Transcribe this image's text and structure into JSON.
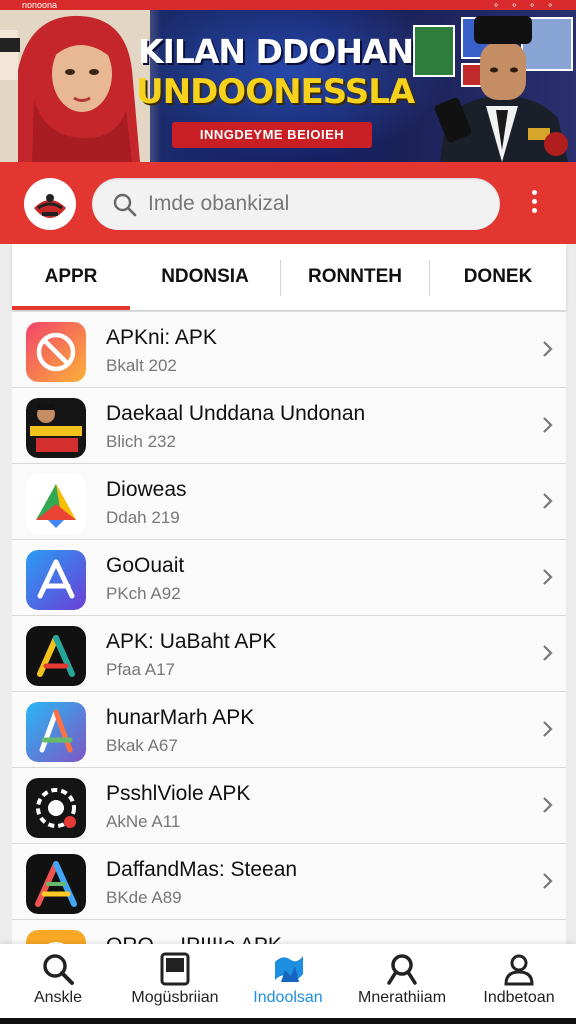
{
  "status_bar": {
    "left": "nonoona",
    "right": "⚬ ⚬ ⚬ ⚬"
  },
  "banner": {
    "title_line1": "KILAN DDOHAN",
    "title_line2": "UNDOONESSLA",
    "subtitle": "INNGDEYME BEIOIEH"
  },
  "header": {
    "search_placeholder": "Imde obankizal"
  },
  "tabs": [
    {
      "label": "APPR",
      "active": true
    },
    {
      "label": "NDONSIA",
      "active": false
    },
    {
      "label": "RONNTEH",
      "active": false
    },
    {
      "label": "DONEK",
      "active": false
    }
  ],
  "apps": [
    {
      "name": "APKni: APK",
      "sub": "Bkalt 202",
      "icon": "no-entry-icon"
    },
    {
      "name": "Daekaal Unddana Undonan",
      "sub": "Blich 232",
      "icon": "apk-badge-icon"
    },
    {
      "name": "Dioweas",
      "sub": "Ddah 219",
      "icon": "drive-triangle-icon"
    },
    {
      "name": "GoOuait",
      "sub": "PKch A92",
      "icon": "app-store-a-icon"
    },
    {
      "name": "APK: UaBaht APK",
      "sub": "Pfaa A17",
      "icon": "triangle-a-icon"
    },
    {
      "name": "hunarMarh APK",
      "sub": "Bkak A67",
      "icon": "blue-a-icon"
    },
    {
      "name": "PsshlViole APK",
      "sub": "AkNe A11",
      "icon": "gear-icon"
    },
    {
      "name": "DaffandMas: Steean",
      "sub": "BKde A89",
      "icon": "rainbow-a-icon"
    },
    {
      "name": "ORO ᵥ ᵤIPIIIIe APK",
      "sub": "",
      "icon": "orange-circle-icon"
    }
  ],
  "bottom_nav": [
    {
      "label": "Anskle",
      "icon": "search-icon"
    },
    {
      "label": "Mogüsbriian",
      "icon": "tablet-icon"
    },
    {
      "label": "Indoolsan",
      "icon": "indonesia-flag-icon",
      "active": true
    },
    {
      "label": "Mnerathiiam",
      "icon": "magnifier-icon"
    },
    {
      "label": "Indbetoan",
      "icon": "person-icon"
    }
  ],
  "colors": {
    "brand_red": "#e33630",
    "active_blue": "#1d8fe0",
    "banner_yellow": "#f7d21c"
  }
}
